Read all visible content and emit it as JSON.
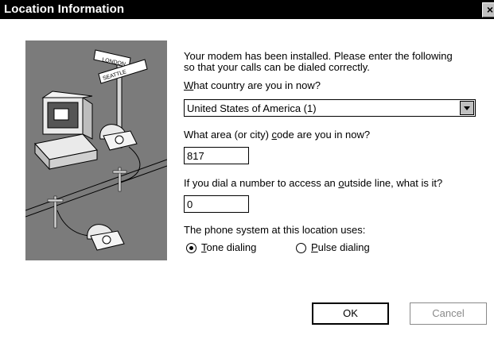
{
  "window": {
    "title": "Location Information",
    "close_glyph": "×"
  },
  "illustration": {
    "signs": [
      "LONDON",
      "SEATTLE"
    ]
  },
  "form": {
    "intro_line1": "Your modem has been installed.  Please enter the following",
    "intro_line2": "so that your calls can be dialed correctly.",
    "country_label_mnemonic": "W",
    "country_label_rest": "hat country are you in now?",
    "country_value": "United States of America (1)",
    "area_label_pre": "What area (or city) ",
    "area_label_mnemonic": "c",
    "area_label_post": "ode are you in now?",
    "area_value": "817",
    "outside_label_pre": "If you dial a number to access an ",
    "outside_label_mnemonic": "o",
    "outside_label_post": "utside line, what is it?",
    "outside_value": "0",
    "phone_system_label": "The phone system at this location uses:",
    "tone_mnemonic": "T",
    "tone_rest": "one dialing",
    "pulse_mnemonic": "P",
    "pulse_rest": "ulse dialing",
    "selected_dialing": "tone"
  },
  "buttons": {
    "ok_label": "OK",
    "cancel_label": "Cancel"
  }
}
